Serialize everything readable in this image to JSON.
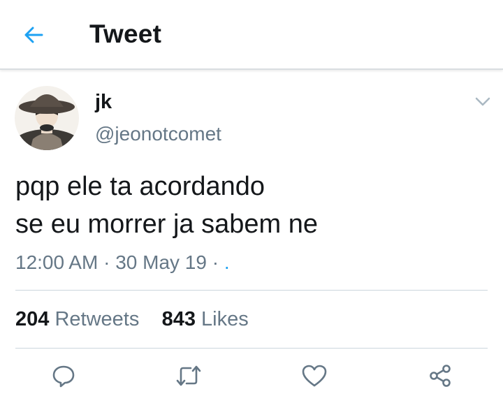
{
  "header": {
    "title": "Tweet",
    "back_icon": "arrow-left-icon",
    "accent": "#1da1f2"
  },
  "author": {
    "display_name": "jk",
    "handle": "@jeonotcomet",
    "menu_icon": "chevron-down-icon"
  },
  "tweet": {
    "lines": [
      "pqp ele ta acordando",
      "se eu morrer ja sabem ne"
    ],
    "time": "12:00 AM",
    "separator": "·",
    "date": "30 May 19",
    "separator2": "·",
    "source": "."
  },
  "stats": {
    "retweets_count": "204",
    "retweets_label": "Retweets",
    "likes_count": "843",
    "likes_label": "Likes"
  },
  "actions": {
    "reply_icon": "reply-icon",
    "retweet_icon": "retweet-icon",
    "like_icon": "heart-icon",
    "share_icon": "share-icon",
    "icon_color": "#657786"
  }
}
